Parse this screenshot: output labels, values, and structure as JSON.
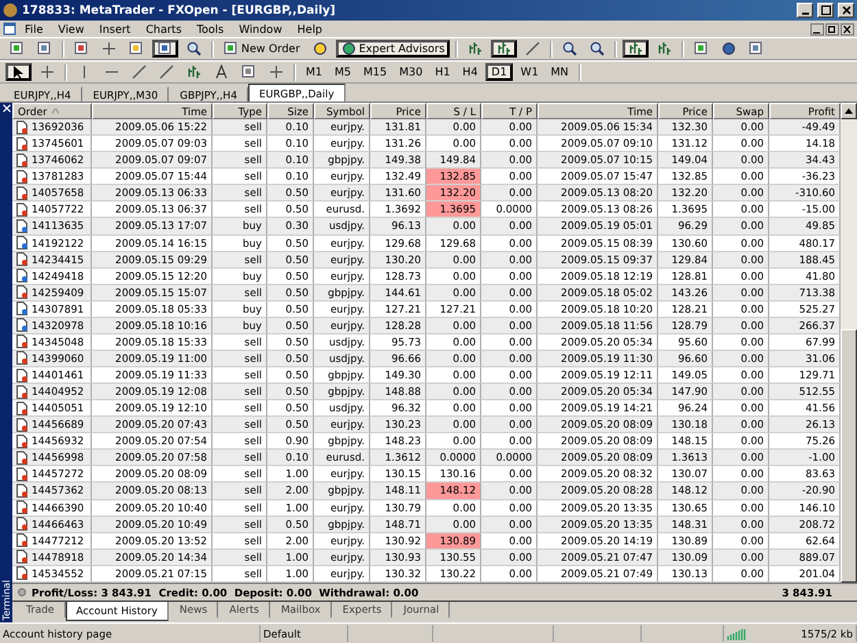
{
  "window": {
    "title": "178833: MetaTrader - FXOpen - [EURGBP,,Daily]"
  },
  "menu": [
    "File",
    "View",
    "Insert",
    "Charts",
    "Tools",
    "Window",
    "Help"
  ],
  "toolbar": {
    "new_order": "New Order",
    "expert_advisors": "Expert Advisors"
  },
  "timeframes": [
    {
      "label": "M1",
      "selected": false
    },
    {
      "label": "M5",
      "selected": false
    },
    {
      "label": "M15",
      "selected": false
    },
    {
      "label": "M30",
      "selected": false
    },
    {
      "label": "H1",
      "selected": false
    },
    {
      "label": "H4",
      "selected": false
    },
    {
      "label": "D1",
      "selected": true
    },
    {
      "label": "W1",
      "selected": false
    },
    {
      "label": "MN",
      "selected": false
    }
  ],
  "chart_tabs": [
    {
      "label": "EURJPY,,H4",
      "selected": false
    },
    {
      "label": "EURJPY,,M30",
      "selected": false
    },
    {
      "label": "GBPJPY,,H4",
      "selected": false
    },
    {
      "label": "EURGBP,,Daily",
      "selected": true
    }
  ],
  "terminal_label": "Terminal",
  "table": {
    "columns": [
      "Order",
      "Time",
      "Type",
      "Size",
      "Symbol",
      "Price",
      "S / L",
      "T / P",
      "Time",
      "Price",
      "Swap",
      "Profit"
    ],
    "rows": [
      {
        "kind": "sell",
        "cells": [
          "13692036",
          "2009.05.06 15:22",
          "sell",
          "0.10",
          "eurjpy.",
          "131.81",
          "0.00",
          "0.00",
          "2009.05.06 15:34",
          "132.30",
          "0.00",
          "-49.49"
        ],
        "sl_hit": false
      },
      {
        "kind": "sell",
        "cells": [
          "13745601",
          "2009.05.07 09:03",
          "sell",
          "0.10",
          "eurjpy.",
          "131.26",
          "0.00",
          "0.00",
          "2009.05.07 09:10",
          "131.12",
          "0.00",
          "14.18"
        ],
        "sl_hit": false
      },
      {
        "kind": "sell",
        "cells": [
          "13746062",
          "2009.05.07 09:07",
          "sell",
          "0.10",
          "gbpjpy.",
          "149.38",
          "149.84",
          "0.00",
          "2009.05.07 10:15",
          "149.04",
          "0.00",
          "34.43"
        ],
        "sl_hit": false
      },
      {
        "kind": "sell",
        "cells": [
          "13781283",
          "2009.05.07 15:44",
          "sell",
          "0.10",
          "eurjpy.",
          "132.49",
          "132.85",
          "0.00",
          "2009.05.07 15:47",
          "132.85",
          "0.00",
          "-36.23"
        ],
        "sl_hit": true
      },
      {
        "kind": "sell",
        "cells": [
          "14057658",
          "2009.05.13 06:33",
          "sell",
          "0.50",
          "eurjpy.",
          "131.60",
          "132.20",
          "0.00",
          "2009.05.13 08:20",
          "132.20",
          "0.00",
          "-310.60"
        ],
        "sl_hit": true
      },
      {
        "kind": "sell",
        "cells": [
          "14057722",
          "2009.05.13 06:37",
          "sell",
          "0.50",
          "eurusd.",
          "1.3692",
          "1.3695",
          "0.0000",
          "2009.05.13 08:26",
          "1.3695",
          "0.00",
          "-15.00"
        ],
        "sl_hit": true
      },
      {
        "kind": "buy",
        "cells": [
          "14113635",
          "2009.05.13 17:07",
          "buy",
          "0.30",
          "usdjpy.",
          "96.13",
          "0.00",
          "0.00",
          "2009.05.19 05:01",
          "96.29",
          "0.00",
          "49.85"
        ],
        "sl_hit": false
      },
      {
        "kind": "buy",
        "cells": [
          "14192122",
          "2009.05.14 16:15",
          "buy",
          "0.50",
          "eurjpy.",
          "129.68",
          "129.68",
          "0.00",
          "2009.05.15 08:39",
          "130.60",
          "0.00",
          "480.17"
        ],
        "sl_hit": false
      },
      {
        "kind": "sell",
        "cells": [
          "14234415",
          "2009.05.15 09:29",
          "sell",
          "0.50",
          "eurjpy.",
          "130.20",
          "0.00",
          "0.00",
          "2009.05.15 09:37",
          "129.84",
          "0.00",
          "188.45"
        ],
        "sl_hit": false
      },
      {
        "kind": "buy",
        "cells": [
          "14249418",
          "2009.05.15 12:20",
          "buy",
          "0.50",
          "eurjpy.",
          "128.73",
          "0.00",
          "0.00",
          "2009.05.18 12:19",
          "128.81",
          "0.00",
          "41.80"
        ],
        "sl_hit": false
      },
      {
        "kind": "sell",
        "cells": [
          "14259409",
          "2009.05.15 15:07",
          "sell",
          "0.50",
          "gbpjpy.",
          "144.61",
          "0.00",
          "0.00",
          "2009.05.18 05:02",
          "143.26",
          "0.00",
          "713.38"
        ],
        "sl_hit": false
      },
      {
        "kind": "buy",
        "cells": [
          "14307891",
          "2009.05.18 05:33",
          "buy",
          "0.50",
          "eurjpy.",
          "127.21",
          "127.21",
          "0.00",
          "2009.05.18 10:20",
          "128.21",
          "0.00",
          "525.27"
        ],
        "sl_hit": false
      },
      {
        "kind": "buy",
        "cells": [
          "14320978",
          "2009.05.18 10:16",
          "buy",
          "0.50",
          "eurjpy.",
          "128.28",
          "0.00",
          "0.00",
          "2009.05.18 11:56",
          "128.79",
          "0.00",
          "266.37"
        ],
        "sl_hit": false
      },
      {
        "kind": "sell",
        "cells": [
          "14345048",
          "2009.05.18 15:33",
          "sell",
          "0.50",
          "usdjpy.",
          "95.73",
          "0.00",
          "0.00",
          "2009.05.20 05:34",
          "95.60",
          "0.00",
          "67.99"
        ],
        "sl_hit": false
      },
      {
        "kind": "sell",
        "cells": [
          "14399060",
          "2009.05.19 11:00",
          "sell",
          "0.50",
          "usdjpy.",
          "96.66",
          "0.00",
          "0.00",
          "2009.05.19 11:30",
          "96.60",
          "0.00",
          "31.06"
        ],
        "sl_hit": false
      },
      {
        "kind": "sell",
        "cells": [
          "14401461",
          "2009.05.19 11:33",
          "sell",
          "0.50",
          "gbpjpy.",
          "149.30",
          "0.00",
          "0.00",
          "2009.05.19 12:11",
          "149.05",
          "0.00",
          "129.71"
        ],
        "sl_hit": false
      },
      {
        "kind": "sell",
        "cells": [
          "14404952",
          "2009.05.19 12:08",
          "sell",
          "0.50",
          "gbpjpy.",
          "148.88",
          "0.00",
          "0.00",
          "2009.05.20 05:34",
          "147.90",
          "0.00",
          "512.55"
        ],
        "sl_hit": false
      },
      {
        "kind": "sell",
        "cells": [
          "14405051",
          "2009.05.19 12:10",
          "sell",
          "0.50",
          "usdjpy.",
          "96.32",
          "0.00",
          "0.00",
          "2009.05.19 14:21",
          "96.24",
          "0.00",
          "41.56"
        ],
        "sl_hit": false
      },
      {
        "kind": "sell",
        "cells": [
          "14456689",
          "2009.05.20 07:43",
          "sell",
          "0.50",
          "eurjpy.",
          "130.23",
          "0.00",
          "0.00",
          "2009.05.20 08:09",
          "130.18",
          "0.00",
          "26.13"
        ],
        "sl_hit": false
      },
      {
        "kind": "sell",
        "cells": [
          "14456932",
          "2009.05.20 07:54",
          "sell",
          "0.90",
          "gbpjpy.",
          "148.23",
          "0.00",
          "0.00",
          "2009.05.20 08:09",
          "148.15",
          "0.00",
          "75.26"
        ],
        "sl_hit": false
      },
      {
        "kind": "sell",
        "cells": [
          "14456998",
          "2009.05.20 07:58",
          "sell",
          "0.10",
          "eurusd.",
          "1.3612",
          "0.0000",
          "0.0000",
          "2009.05.20 08:09",
          "1.3613",
          "0.00",
          "-1.00"
        ],
        "sl_hit": false
      },
      {
        "kind": "sell",
        "cells": [
          "14457272",
          "2009.05.20 08:09",
          "sell",
          "1.00",
          "eurjpy.",
          "130.15",
          "130.16",
          "0.00",
          "2009.05.20 08:32",
          "130.07",
          "0.00",
          "83.63"
        ],
        "sl_hit": false
      },
      {
        "kind": "sell",
        "cells": [
          "14457362",
          "2009.05.20 08:13",
          "sell",
          "2.00",
          "gbpjpy.",
          "148.11",
          "148.12",
          "0.00",
          "2009.05.20 08:28",
          "148.12",
          "0.00",
          "-20.90"
        ],
        "sl_hit": true
      },
      {
        "kind": "sell",
        "cells": [
          "14466390",
          "2009.05.20 10:40",
          "sell",
          "1.00",
          "eurjpy.",
          "130.79",
          "0.00",
          "0.00",
          "2009.05.20 13:35",
          "130.65",
          "0.00",
          "146.10"
        ],
        "sl_hit": false
      },
      {
        "kind": "sell",
        "cells": [
          "14466463",
          "2009.05.20 10:49",
          "sell",
          "0.50",
          "gbpjpy.",
          "148.71",
          "0.00",
          "0.00",
          "2009.05.20 13:35",
          "148.31",
          "0.00",
          "208.72"
        ],
        "sl_hit": false
      },
      {
        "kind": "sell",
        "cells": [
          "14477212",
          "2009.05.20 13:52",
          "sell",
          "2.00",
          "eurjpy.",
          "130.92",
          "130.89",
          "0.00",
          "2009.05.20 14:19",
          "130.89",
          "0.00",
          "62.64"
        ],
        "sl_hit": true
      },
      {
        "kind": "sell",
        "cells": [
          "14478918",
          "2009.05.20 14:34",
          "sell",
          "1.00",
          "eurjpy.",
          "130.93",
          "130.55",
          "0.00",
          "2009.05.21 07:47",
          "130.09",
          "0.00",
          "889.07"
        ],
        "sl_hit": false
      },
      {
        "kind": "sell",
        "cells": [
          "14534552",
          "2009.05.21 07:15",
          "sell",
          "1.00",
          "eurjpy.",
          "130.32",
          "130.22",
          "0.00",
          "2009.05.21 07:49",
          "130.13",
          "0.00",
          "201.04"
        ],
        "sl_hit": false
      }
    ]
  },
  "summary": {
    "text": "Profit/Loss: 3 843.91  Credit: 0.00  Deposit: 0.00  Withdrawal: 0.00",
    "total": "3 843.91"
  },
  "terminal_tabs": [
    {
      "label": "Trade",
      "selected": false
    },
    {
      "label": "Account History",
      "selected": true
    },
    {
      "label": "News",
      "selected": false
    },
    {
      "label": "Alerts",
      "selected": false
    },
    {
      "label": "Mailbox",
      "selected": false
    },
    {
      "label": "Experts",
      "selected": false
    },
    {
      "label": "Journal",
      "selected": false
    }
  ],
  "status_bar": {
    "hint": "Account history page",
    "profile": "Default",
    "traffic": "1575/2 kb"
  }
}
